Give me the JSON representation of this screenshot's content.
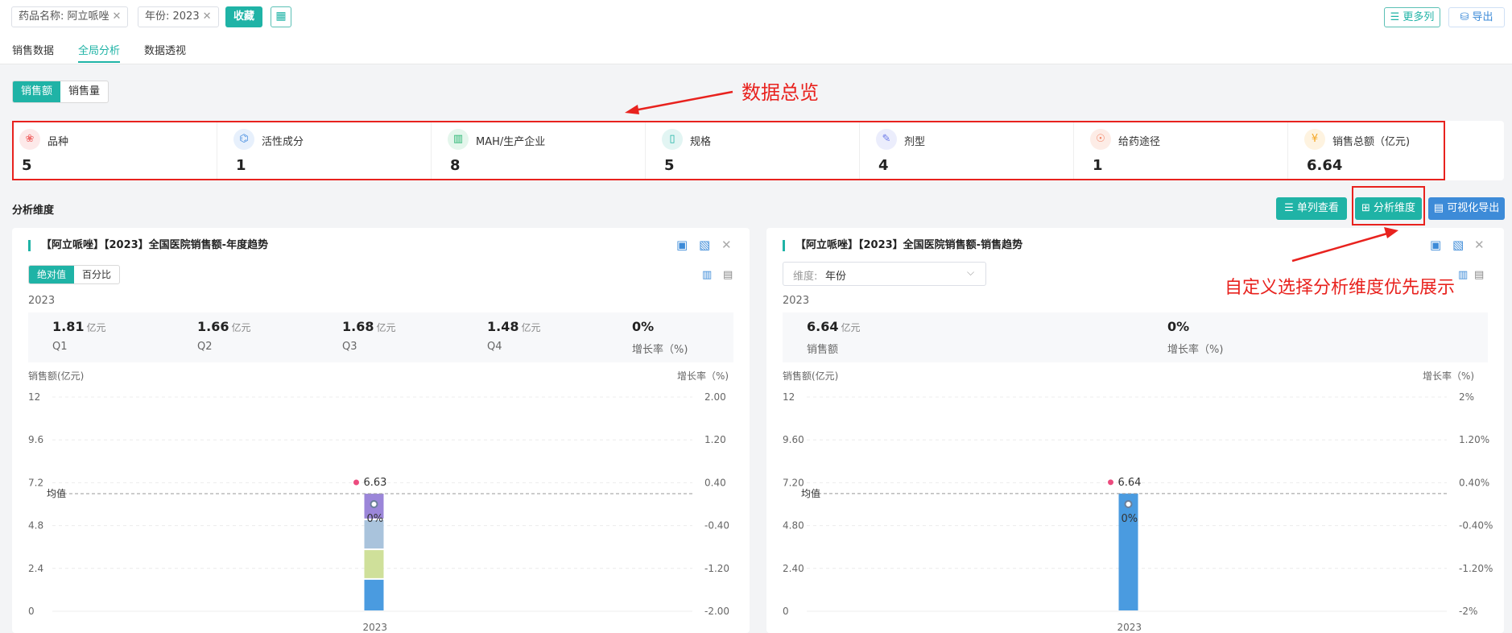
{
  "filters": {
    "drug_chip": "药品名称: 阿立哌唑",
    "year_chip": "年份: 2023",
    "collect_button": "收藏",
    "more_columns": "更多列",
    "export": "导出"
  },
  "tabs": [
    "销售数据",
    "全局分析",
    "数据透视"
  ],
  "active_tab": 1,
  "metric_toggle": [
    "销售额",
    "销售量"
  ],
  "summary_stats": [
    {
      "label": "品种",
      "value": "5",
      "icon": "varieties-icon",
      "color": "#f06a6a"
    },
    {
      "label": "活性成分",
      "value": "1",
      "icon": "molecule-icon",
      "color": "#4a8fe0"
    },
    {
      "label": "MAH/生产企业",
      "value": "8",
      "icon": "building-icon",
      "color": "#2bb673"
    },
    {
      "label": "规格",
      "value": "5",
      "icon": "spec-icon",
      "color": "#1fb3a6"
    },
    {
      "label": "剂型",
      "value": "4",
      "icon": "pill-icon",
      "color": "#6a78e8"
    },
    {
      "label": "给药途径",
      "value": "1",
      "icon": "route-icon",
      "color": "#f07a5a"
    },
    {
      "label": "销售总额（亿元)",
      "value": "6.64",
      "icon": "money-icon",
      "color": "#f5a623"
    }
  ],
  "section_title": "分析维度",
  "section_buttons": {
    "single_column": "单列查看",
    "dimension": "分析维度",
    "visual_export": "可视化导出"
  },
  "annotations": {
    "overview": "数据总览",
    "custom_dimension": "自定义选择分析维度优先展示"
  },
  "left_panel": {
    "title": "【阿立哌唑】【2023】全国医院销售额-年度趋势",
    "toggle": [
      "绝对值",
      "百分比"
    ],
    "period": "2023",
    "kpis": [
      {
        "value": "1.81",
        "unit": "亿元",
        "label": "Q1"
      },
      {
        "value": "1.66",
        "unit": "亿元",
        "label": "Q2"
      },
      {
        "value": "1.68",
        "unit": "亿元",
        "label": "Q3"
      },
      {
        "value": "1.48",
        "unit": "亿元",
        "label": "Q4"
      },
      {
        "value": "0%",
        "unit": "",
        "label": "增长率（%)"
      }
    ],
    "y_left_title": "销售额(亿元)",
    "y_right_title": "增长率（%)",
    "mean_label": "均值",
    "growth_label": "0%"
  },
  "right_panel": {
    "title": "【阿立哌唑】【2023】全国医院销售额-销售趋势",
    "select_label": "维度:",
    "select_value": "年份",
    "period": "2023",
    "kpis": [
      {
        "value": "6.64",
        "unit": "亿元",
        "label": "销售额"
      },
      {
        "value": "0%",
        "unit": "",
        "label": "增长率（%)"
      }
    ],
    "y_left_title": "销售额(亿元)",
    "y_right_title": "增长率（%)",
    "mean_label": "均值",
    "growth_label": "0%"
  },
  "chart_data": [
    {
      "type": "bar",
      "title": "【阿立哌唑】【2023】全国医院销售额-年度趋势",
      "categories": [
        "2023"
      ],
      "series": [
        {
          "values": [
            1.81
          ],
          "color": "#4a9be0"
        },
        {
          "values": [
            1.66
          ],
          "color": "#cfe09a"
        },
        {
          "values": [
            1.68
          ],
          "color": "#a9c3dc"
        },
        {
          "values": [
            1.48
          ],
          "color": "#9b86d9"
        }
      ],
      "total_label": "6.63",
      "ylim": [
        0,
        12
      ],
      "yticks": [
        "0",
        "2.4",
        "4.8",
        "7.2",
        "9.6",
        "12"
      ],
      "y2lim": [
        -2,
        2
      ],
      "y2ticks": [
        "-2.00",
        "-1.20",
        "-0.40",
        "0.40",
        "1.20",
        "2.00"
      ],
      "growth": [
        0
      ],
      "mean": 6.63,
      "xlabel": "",
      "ylabel": "销售额(亿元)",
      "y2label": "增长率（%)"
    },
    {
      "type": "bar",
      "title": "【阿立哌唑】【2023】全国医院销售额-销售趋势",
      "categories": [
        "2023"
      ],
      "series": [
        {
          "values": [
            6.64
          ],
          "color": "#4a9be0"
        }
      ],
      "total_label": "6.64",
      "ylim": [
        0,
        12
      ],
      "yticks": [
        "0",
        "2.40",
        "4.80",
        "7.20",
        "9.60",
        "12"
      ],
      "y2lim": [
        -2,
        2
      ],
      "y2ticks": [
        "-2%",
        "-1.20%",
        "-0.40%",
        "0.40%",
        "1.20%",
        "2%"
      ],
      "growth": [
        0
      ],
      "mean": 6.64,
      "xlabel": "",
      "ylabel": "销售额(亿元)",
      "y2label": "增长率（%)"
    }
  ]
}
